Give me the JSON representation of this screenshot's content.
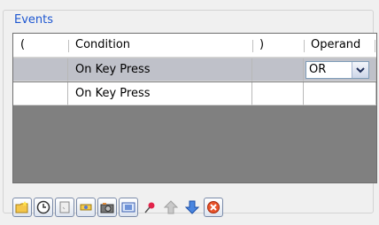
{
  "group": {
    "title": "Events"
  },
  "grid": {
    "columns": [
      "(",
      "Condition",
      ")",
      "Operand"
    ],
    "rows": [
      {
        "open": "",
        "condition": "On Key Press",
        "close": "",
        "operand": "OR"
      },
      {
        "open": "",
        "condition": "On Key Press",
        "close": "",
        "operand": ""
      }
    ]
  },
  "toolbar": {
    "buttons": [
      "new-folder-icon",
      "clock-icon",
      "blank-card-icon",
      "gear-icon",
      "camera-icon",
      "picture-icon",
      "pin-icon",
      "up-arrow-icon",
      "down-arrow-icon",
      "delete-icon"
    ]
  }
}
